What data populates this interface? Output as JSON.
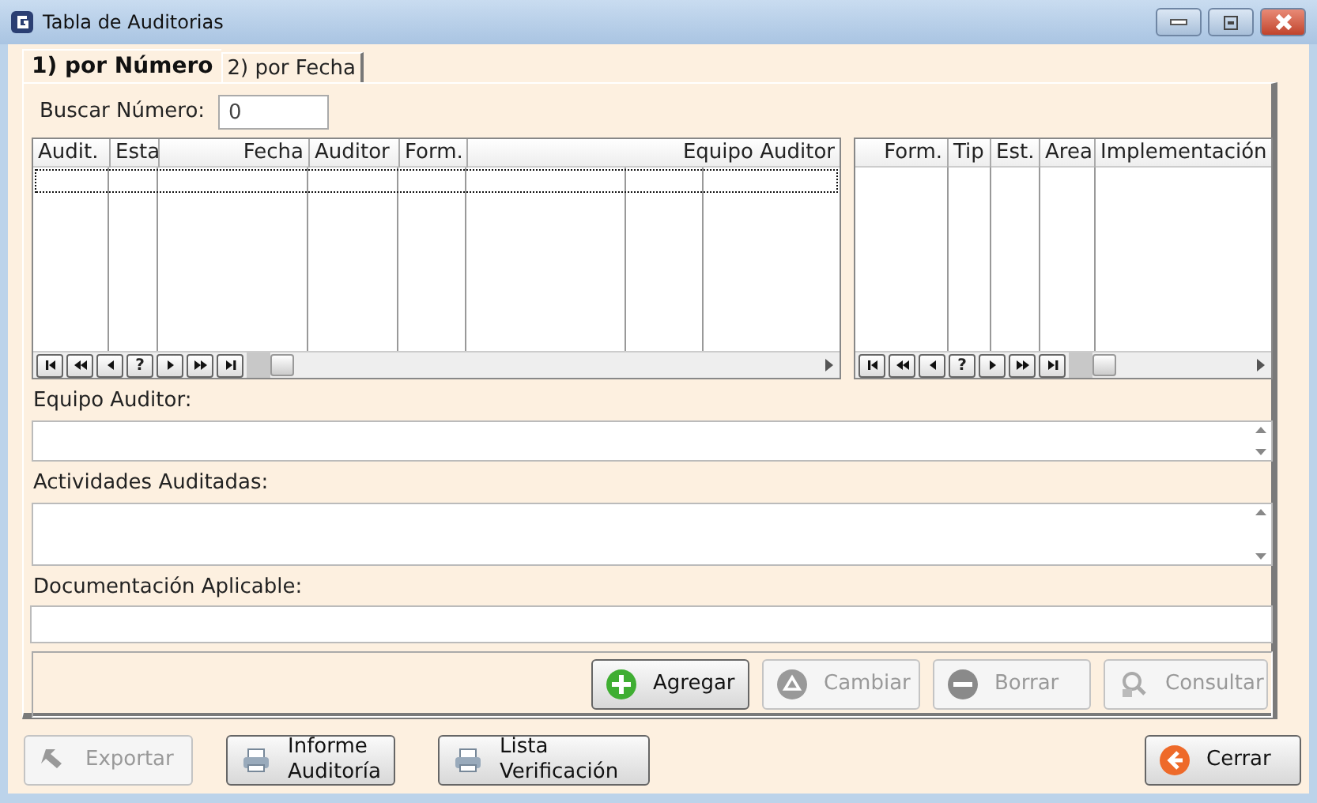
{
  "window": {
    "title": "Tabla de Auditorias"
  },
  "tabs": [
    {
      "label": "1) por Número",
      "selected": true
    },
    {
      "label": "2) por Fecha",
      "selected": false
    }
  ],
  "search": {
    "label": "Buscar Número:",
    "value": "0"
  },
  "grid_left": {
    "columns": [
      "Audit.",
      "Esta",
      "Fecha",
      "Auditor",
      "Form.",
      "Equipo Auditor"
    ],
    "navigator": {
      "help": "?"
    }
  },
  "grid_right": {
    "columns": [
      "Form.",
      "Tip",
      "Est.",
      "Area",
      "Implementación"
    ],
    "navigator": {
      "help": "?"
    }
  },
  "fields": [
    {
      "label": "Equipo Auditor:",
      "kind": "scrolled"
    },
    {
      "label": "Actividades Auditadas:",
      "kind": "scrolled"
    },
    {
      "label": "Documentación Aplicable:",
      "kind": "line"
    }
  ],
  "actions": [
    {
      "label": "Agregar",
      "disabled": false
    },
    {
      "label": "Cambiar",
      "disabled": true
    },
    {
      "label": "Borrar",
      "disabled": true
    },
    {
      "label": "Consultar",
      "disabled": true
    }
  ],
  "bottom_buttons": [
    {
      "label": "Exportar",
      "disabled": true
    },
    {
      "label": "Informe\nAuditoría",
      "disabled": false
    },
    {
      "label": "Lista\nVerificación",
      "disabled": false
    },
    {
      "label": "Cerrar",
      "disabled": false
    }
  ]
}
